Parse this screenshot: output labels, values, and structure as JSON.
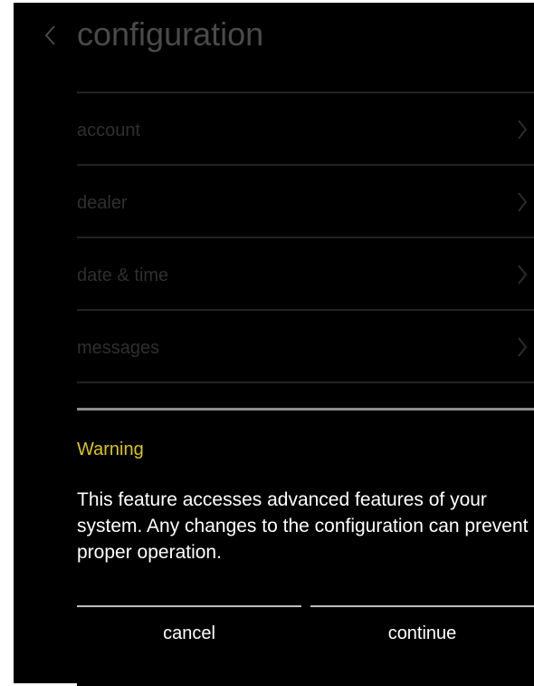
{
  "header": {
    "title": "configuration",
    "back_icon": "chevron-left-icon"
  },
  "menu": {
    "items": [
      {
        "label": "account",
        "icon": "chevron-right-icon"
      },
      {
        "label": "dealer",
        "icon": "chevron-right-icon"
      },
      {
        "label": "date & time",
        "icon": "chevron-right-icon"
      },
      {
        "label": "messages",
        "icon": "chevron-right-icon"
      }
    ]
  },
  "dialog": {
    "title": "Warning",
    "body": "This feature accesses advanced features of your system. Any changes to the configuration can prevent proper operation.",
    "cancel_label": "cancel",
    "continue_label": "continue"
  },
  "colors": {
    "background": "#000000",
    "warning_title": "#d9c51d",
    "dimmed_text": "#2f2f2f",
    "dialog_text": "#ffffff"
  }
}
